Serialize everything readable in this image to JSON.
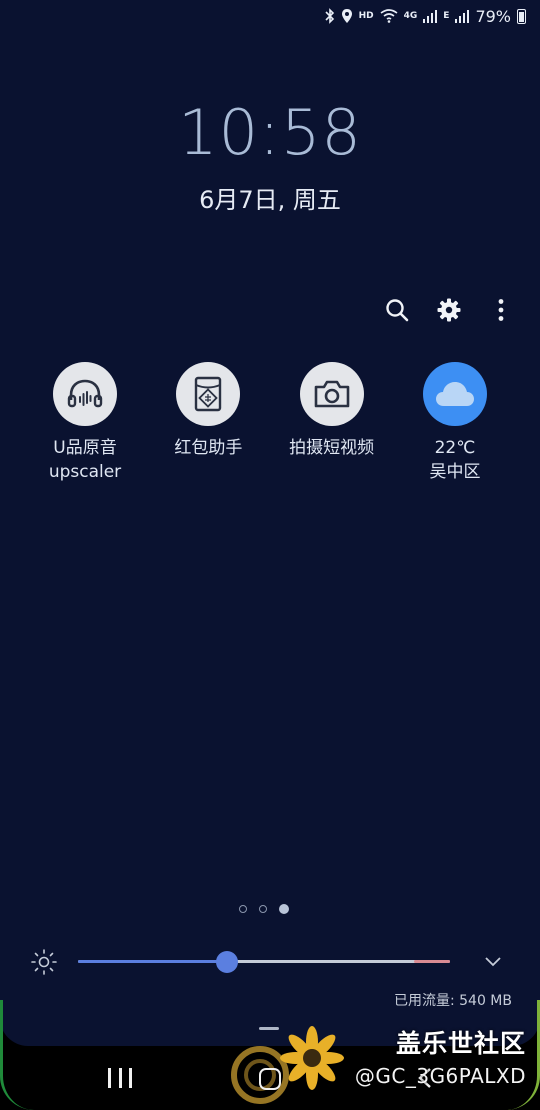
{
  "status_bar": {
    "icons": [
      "bluetooth-icon",
      "location-icon",
      "hd-icon",
      "wifi-icon",
      "signal-icon",
      "signal-icon",
      "battery-icon"
    ],
    "hd_label": "HD",
    "net1_label": "4G",
    "net2_label": "E",
    "battery": "79%"
  },
  "clock": {
    "time": "10:58",
    "date": "6月7日, 周五"
  },
  "actions": {
    "icons": [
      "search-icon",
      "gear-icon",
      "more-vert-icon"
    ]
  },
  "shortcuts": [
    {
      "label_line1": "U品原音",
      "label_line2": "upscaler",
      "icon": "headphones-icon"
    },
    {
      "label_line1": "红包助手",
      "label_line2": "",
      "icon": "red-envelope-icon"
    },
    {
      "label_line1": "拍摄短视频",
      "label_line2": "",
      "icon": "camera-icon"
    },
    {
      "label_line1": "22℃",
      "label_line2": "吴中区",
      "icon": "cloud-icon"
    }
  ],
  "pager": {
    "count": 3,
    "active_index": 2
  },
  "brightness": {
    "level": 0.4,
    "accent": "#5b7fe0"
  },
  "data_usage": "已用流量: 540 MB",
  "watermark": {
    "brand": "盖乐世社区",
    "user": "@GC_3G6PALXD"
  },
  "colors": {
    "panel_bg": "#0a1230",
    "weather_circle": "#3d8ff3",
    "shortcut_circle": "#e4e6ea"
  }
}
